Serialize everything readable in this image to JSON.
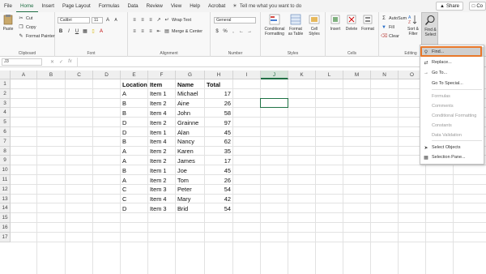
{
  "menu": {
    "items": [
      "File",
      "Home",
      "Insert",
      "Page Layout",
      "Formulas",
      "Data",
      "Review",
      "View",
      "Help",
      "Acrobat"
    ],
    "active": "Home",
    "tell_me": "Tell me what you want to do",
    "share": "Share",
    "comments": "Co"
  },
  "ribbon": {
    "clipboard": {
      "cut": "Cut",
      "copy": "Copy",
      "format_painter": "Format Painter",
      "paste": "Paste",
      "label": "Clipboard"
    },
    "font": {
      "name": "Calibri",
      "size": "11",
      "label": "Font"
    },
    "alignment": {
      "wrap_text": "Wrap Text",
      "merge_center": "Merge & Center",
      "label": "Alignment"
    },
    "number": {
      "format": "General",
      "label": "Number"
    },
    "styles": {
      "conditional": "Conditional Formatting",
      "format_table": "Format as Table",
      "cell_styles": "Cell Styles",
      "label": "Styles"
    },
    "cells": {
      "insert": "Insert",
      "delete": "Delete",
      "format": "Format",
      "label": "Cells"
    },
    "editing": {
      "autosum": "AutoSum",
      "fill": "Fill",
      "clear": "Clear",
      "sort_filter": "Sort & Filter",
      "find_select": "Find & Select",
      "label": "Editing"
    }
  },
  "formula_bar": {
    "name_box": "J3",
    "fx": "fx",
    "value": ""
  },
  "sheet": {
    "columns": [
      "A",
      "B",
      "C",
      "D",
      "E",
      "F",
      "G",
      "H",
      "I",
      "J",
      "K",
      "L",
      "M",
      "N",
      "O",
      "P"
    ],
    "selected_column": "J",
    "rows": [
      "1",
      "2",
      "3",
      "4",
      "5",
      "6",
      "7",
      "8",
      "9",
      "10",
      "11",
      "12",
      "13",
      "14",
      "15",
      "16",
      "17"
    ],
    "headers": [
      "Location",
      "Item",
      "Name",
      "Total"
    ],
    "data": [
      [
        "A",
        "Item 1",
        "Michael",
        "17"
      ],
      [
        "B",
        "Item 2",
        "Aine",
        "26"
      ],
      [
        "B",
        "Item 4",
        "John",
        "58"
      ],
      [
        "D",
        "Item 2",
        "Grainne",
        "97"
      ],
      [
        "D",
        "Item 1",
        "Alan",
        "45"
      ],
      [
        "B",
        "Item 4",
        "Nancy",
        "62"
      ],
      [
        "A",
        "Item 2",
        "Karen",
        "35"
      ],
      [
        "A",
        "Item 2",
        "James",
        "17"
      ],
      [
        "B",
        "Item 1",
        "Joe",
        "45"
      ],
      [
        "A",
        "Item 2",
        "Tom",
        "26"
      ],
      [
        "C",
        "Item 3",
        "Peter",
        "54"
      ],
      [
        "C",
        "Item 4",
        "Mary",
        "42"
      ],
      [
        "D",
        "Item 3",
        "Brid",
        "54"
      ]
    ]
  },
  "find_menu": {
    "items": [
      {
        "label": "Find...",
        "icon": "search-icon",
        "enabled": true
      },
      {
        "label": "Replace...",
        "icon": "replace-icon",
        "enabled": true
      },
      {
        "label": "Go To...",
        "icon": "arrow-right-icon",
        "enabled": true
      },
      {
        "label": "Go To Special...",
        "icon": "",
        "enabled": true
      },
      {
        "label": "Formulas",
        "icon": "",
        "enabled": false
      },
      {
        "label": "Comments",
        "icon": "",
        "enabled": false
      },
      {
        "label": "Conditional Formatting",
        "icon": "",
        "enabled": false
      },
      {
        "label": "Constants",
        "icon": "",
        "enabled": false
      },
      {
        "label": "Data Validation",
        "icon": "",
        "enabled": false
      },
      {
        "label": "Select Objects",
        "icon": "pointer-icon",
        "enabled": true
      },
      {
        "label": "Selection Pane...",
        "icon": "selection-pane-icon",
        "enabled": true
      }
    ]
  },
  "colors": {
    "accent": "#217346",
    "highlight": "#e8782a"
  }
}
